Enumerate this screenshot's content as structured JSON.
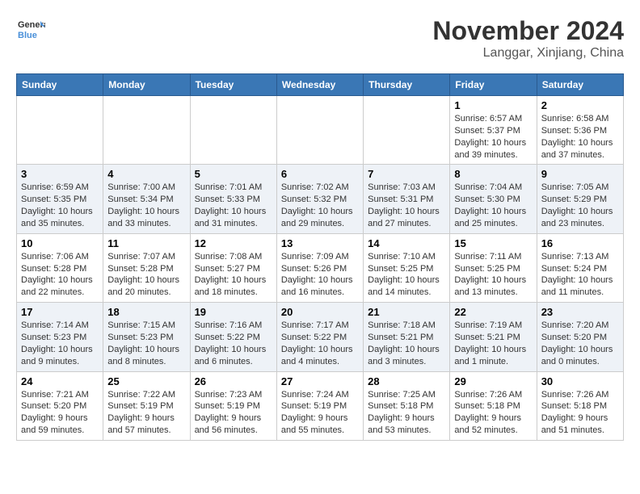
{
  "logo": {
    "line1": "General",
    "line2": "Blue"
  },
  "title": "November 2024",
  "location": "Langgar, Xinjiang, China",
  "weekdays": [
    "Sunday",
    "Monday",
    "Tuesday",
    "Wednesday",
    "Thursday",
    "Friday",
    "Saturday"
  ],
  "weeks": [
    [
      {
        "day": "",
        "info": ""
      },
      {
        "day": "",
        "info": ""
      },
      {
        "day": "",
        "info": ""
      },
      {
        "day": "",
        "info": ""
      },
      {
        "day": "",
        "info": ""
      },
      {
        "day": "1",
        "info": "Sunrise: 6:57 AM\nSunset: 5:37 PM\nDaylight: 10 hours and 39 minutes."
      },
      {
        "day": "2",
        "info": "Sunrise: 6:58 AM\nSunset: 5:36 PM\nDaylight: 10 hours and 37 minutes."
      }
    ],
    [
      {
        "day": "3",
        "info": "Sunrise: 6:59 AM\nSunset: 5:35 PM\nDaylight: 10 hours and 35 minutes."
      },
      {
        "day": "4",
        "info": "Sunrise: 7:00 AM\nSunset: 5:34 PM\nDaylight: 10 hours and 33 minutes."
      },
      {
        "day": "5",
        "info": "Sunrise: 7:01 AM\nSunset: 5:33 PM\nDaylight: 10 hours and 31 minutes."
      },
      {
        "day": "6",
        "info": "Sunrise: 7:02 AM\nSunset: 5:32 PM\nDaylight: 10 hours and 29 minutes."
      },
      {
        "day": "7",
        "info": "Sunrise: 7:03 AM\nSunset: 5:31 PM\nDaylight: 10 hours and 27 minutes."
      },
      {
        "day": "8",
        "info": "Sunrise: 7:04 AM\nSunset: 5:30 PM\nDaylight: 10 hours and 25 minutes."
      },
      {
        "day": "9",
        "info": "Sunrise: 7:05 AM\nSunset: 5:29 PM\nDaylight: 10 hours and 23 minutes."
      }
    ],
    [
      {
        "day": "10",
        "info": "Sunrise: 7:06 AM\nSunset: 5:28 PM\nDaylight: 10 hours and 22 minutes."
      },
      {
        "day": "11",
        "info": "Sunrise: 7:07 AM\nSunset: 5:28 PM\nDaylight: 10 hours and 20 minutes."
      },
      {
        "day": "12",
        "info": "Sunrise: 7:08 AM\nSunset: 5:27 PM\nDaylight: 10 hours and 18 minutes."
      },
      {
        "day": "13",
        "info": "Sunrise: 7:09 AM\nSunset: 5:26 PM\nDaylight: 10 hours and 16 minutes."
      },
      {
        "day": "14",
        "info": "Sunrise: 7:10 AM\nSunset: 5:25 PM\nDaylight: 10 hours and 14 minutes."
      },
      {
        "day": "15",
        "info": "Sunrise: 7:11 AM\nSunset: 5:25 PM\nDaylight: 10 hours and 13 minutes."
      },
      {
        "day": "16",
        "info": "Sunrise: 7:13 AM\nSunset: 5:24 PM\nDaylight: 10 hours and 11 minutes."
      }
    ],
    [
      {
        "day": "17",
        "info": "Sunrise: 7:14 AM\nSunset: 5:23 PM\nDaylight: 10 hours and 9 minutes."
      },
      {
        "day": "18",
        "info": "Sunrise: 7:15 AM\nSunset: 5:23 PM\nDaylight: 10 hours and 8 minutes."
      },
      {
        "day": "19",
        "info": "Sunrise: 7:16 AM\nSunset: 5:22 PM\nDaylight: 10 hours and 6 minutes."
      },
      {
        "day": "20",
        "info": "Sunrise: 7:17 AM\nSunset: 5:22 PM\nDaylight: 10 hours and 4 minutes."
      },
      {
        "day": "21",
        "info": "Sunrise: 7:18 AM\nSunset: 5:21 PM\nDaylight: 10 hours and 3 minutes."
      },
      {
        "day": "22",
        "info": "Sunrise: 7:19 AM\nSunset: 5:21 PM\nDaylight: 10 hours and 1 minute."
      },
      {
        "day": "23",
        "info": "Sunrise: 7:20 AM\nSunset: 5:20 PM\nDaylight: 10 hours and 0 minutes."
      }
    ],
    [
      {
        "day": "24",
        "info": "Sunrise: 7:21 AM\nSunset: 5:20 PM\nDaylight: 9 hours and 59 minutes."
      },
      {
        "day": "25",
        "info": "Sunrise: 7:22 AM\nSunset: 5:19 PM\nDaylight: 9 hours and 57 minutes."
      },
      {
        "day": "26",
        "info": "Sunrise: 7:23 AM\nSunset: 5:19 PM\nDaylight: 9 hours and 56 minutes."
      },
      {
        "day": "27",
        "info": "Sunrise: 7:24 AM\nSunset: 5:19 PM\nDaylight: 9 hours and 55 minutes."
      },
      {
        "day": "28",
        "info": "Sunrise: 7:25 AM\nSunset: 5:18 PM\nDaylight: 9 hours and 53 minutes."
      },
      {
        "day": "29",
        "info": "Sunrise: 7:26 AM\nSunset: 5:18 PM\nDaylight: 9 hours and 52 minutes."
      },
      {
        "day": "30",
        "info": "Sunrise: 7:26 AM\nSunset: 5:18 PM\nDaylight: 9 hours and 51 minutes."
      }
    ]
  ]
}
